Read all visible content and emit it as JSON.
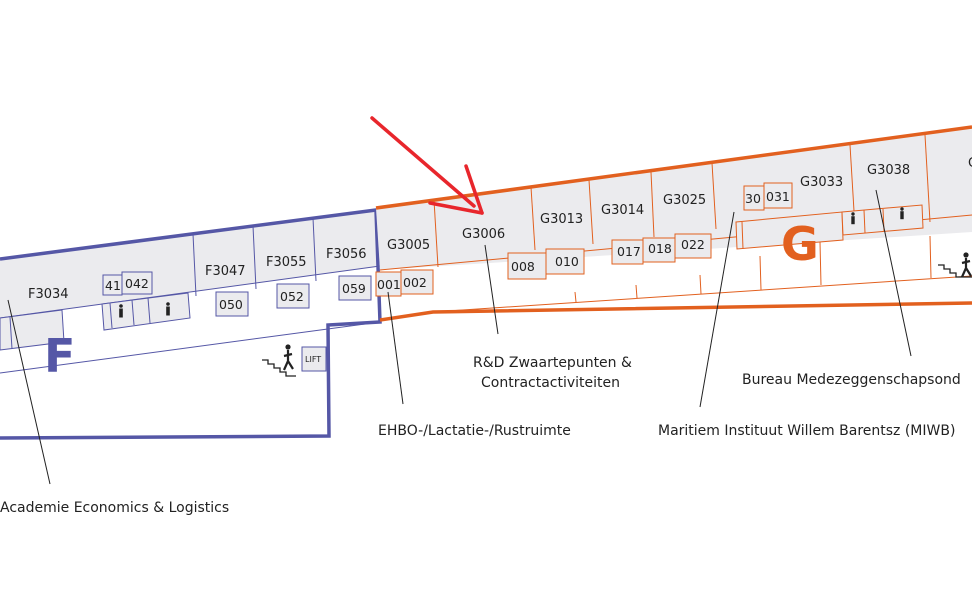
{
  "wings": {
    "F": {
      "letter": "F",
      "color": "#5557a6"
    },
    "G": {
      "letter": "G",
      "color": "#e2601f"
    }
  },
  "lift_label": "LIFT",
  "rooms_f": {
    "F3034": "F3034",
    "F3047": "F3047",
    "F3055": "F3055",
    "F3056": "F3056",
    "r041": "41",
    "r042": "042",
    "r050": "050",
    "r052": "052",
    "r059": "059"
  },
  "rooms_g": {
    "G3005": "G3005",
    "G3006": "G3006",
    "G3013": "G3013",
    "G3014": "G3014",
    "G3025": "G3025",
    "G3033": "G3033",
    "G3038": "G3038",
    "r001": "001",
    "r002": "002",
    "r008": "008",
    "r010": "010",
    "r017": "017",
    "r018": "018",
    "r022": "022",
    "r030": "30",
    "r031": "031"
  },
  "labels": {
    "academie": "Academie Economics & Logistics",
    "ehbo": "EHBO-/Lactatie-/Rustruimte",
    "rd_line1": "R&D Zwaartepunten &",
    "rd_line2": "Contractactiviteiten",
    "miwb": "Maritiem Instituut Willem Barentsz (MIWB)",
    "bureau": "Bureau Medezeggenschapsond"
  },
  "icons": {
    "arrow": "red-arrow-icon",
    "stairs": "stairs-person-icon",
    "toilet": "toilet-person-icon"
  },
  "colors": {
    "arrow": "#e8262c",
    "room_fill": "#ebebee"
  }
}
